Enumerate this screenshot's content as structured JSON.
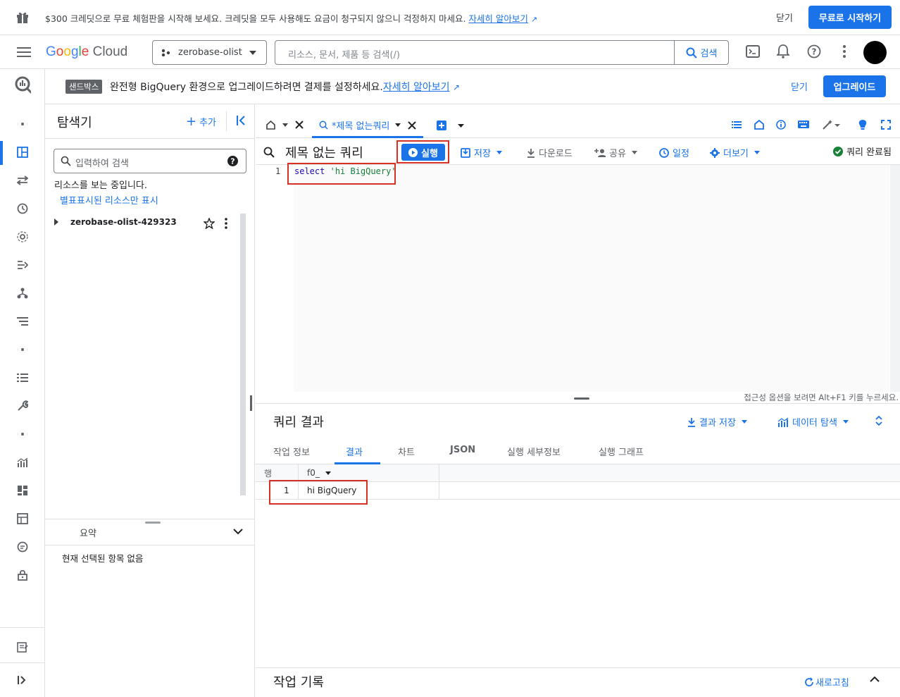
{
  "promo": {
    "message": "$300 크레딧으로 무료 체험판을 시작해 보세요. 크레딧을 모두 사용해도 요금이 청구되지 않으니 걱정하지 마세요.",
    "learn_more": "자세히 알아보기",
    "close": "닫기",
    "start": "무료로 시작하기"
  },
  "header": {
    "logo": "Google Cloud",
    "project": "zerobase-olist",
    "search_placeholder": "리소스, 문서, 제품 등 검색(/)",
    "search_button": "검색"
  },
  "sandbox": {
    "tag": "샌드박스",
    "message": "완전형 BigQuery 환경으로 업그레이드하려면 결제를 설정하세요.",
    "learn_more": "자세히 알아보기",
    "close": "닫기",
    "upgrade": "업그레이드"
  },
  "explorer": {
    "title": "탐색기",
    "add": "추가",
    "search_placeholder": "입력하여 검색",
    "viewing": "리소스를 보는 중입니다.",
    "starred_only": "별표표시된 리소스만 표시",
    "project_id": "zerobase-olist-429323",
    "summary": "요약",
    "no_selection": "현재 선택된 항목 없음"
  },
  "editor": {
    "tab_label": "*제목 없는쿼리",
    "query_title": "제목 없는 쿼리",
    "run": "실행",
    "save": "저장",
    "download": "다운로드",
    "share": "공유",
    "schedule": "일정",
    "more": "더보기",
    "status": "쿼리 완료됨",
    "line_number": "1",
    "code_keyword": "select",
    "code_string": "'hi BigQuery'",
    "a11y_hint": "접근성 옵션을 보려면 Alt+F1 키를 누르세요."
  },
  "results": {
    "title": "쿼리 결과",
    "save_results": "결과 저장",
    "explore_data": "데이터 탐색",
    "tabs": [
      "작업 정보",
      "결과",
      "차트",
      "JSON",
      "실행 세부정보",
      "실행 그래프"
    ],
    "col_row": "행",
    "col_f0": "f0_",
    "row_number": "1",
    "row_value": "hi BigQuery"
  },
  "jobs": {
    "title": "작업 기록",
    "refresh": "새로고침"
  },
  "colors": {
    "accent": "#1a73e8",
    "highlight": "#d93025"
  }
}
